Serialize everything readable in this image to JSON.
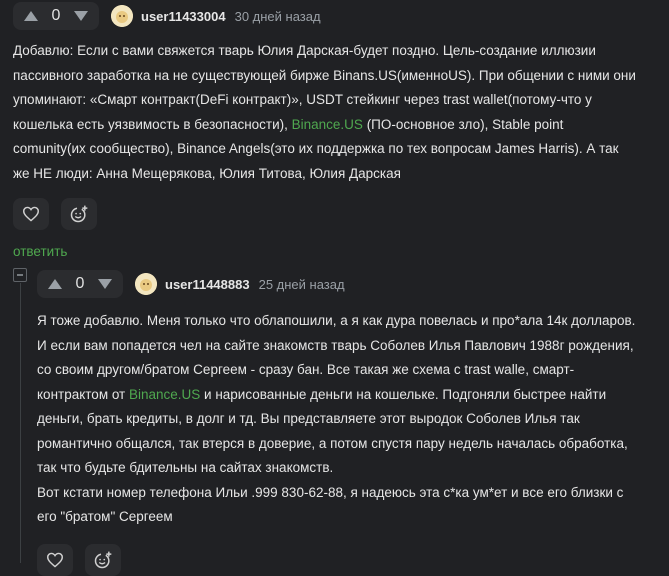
{
  "comments": [
    {
      "votes": "0",
      "user": "user11433004",
      "time": "30 дней назад",
      "lines": [
        [
          {
            "t": "Добавлю: Если с вами свяжется тварь Юлия Дарская-будет поздно. Цель-создание иллюзии"
          }
        ],
        [
          {
            "t": "пассивного заработка на не существующей бирже Binans.US(именноUS). При общении с ними они"
          }
        ],
        [
          {
            "t": "упоминают: «Смарт контракт(DeFi контракт)», USDT стейкинг через trast wallet(потому-что у"
          }
        ],
        [
          {
            "t": "кошелька есть уязвимость в безопасности), "
          },
          {
            "t": "Binance.US",
            "link": true
          },
          {
            "t": " (ПО-основное зло), Stable point"
          }
        ],
        [
          {
            "t": "comunity(их сообщество), Binance Angels(это их поддержка по тех вопросам James Harris). А так"
          }
        ],
        [
          {
            "t": "же НЕ люди: Анна Мещерякова, Юлия Титова, Юлия Дарская"
          }
        ]
      ],
      "reply_label": "ответить"
    },
    {
      "votes": "0",
      "user": "user11448883",
      "time": "25 дней назад",
      "lines": [
        [
          {
            "t": "Я тоже добавлю. Меня только что облапошили, а я как дура повелась и про*ала 14к долларов."
          }
        ],
        [
          {
            "t": "И если вам попадется чел на сайте знакомств тварь Соболев Илья Павлович 1988г рождения,"
          }
        ],
        [
          {
            "t": "со своим другом/братом Сергеем - сразу бан. Все такая же схема с trast walle, смарт-"
          }
        ],
        [
          {
            "t": "контрактом от "
          },
          {
            "t": "Binance.US",
            "link": true
          },
          {
            "t": " и нарисованные деньги на кошельке. Подгоняли быстрее найти"
          }
        ],
        [
          {
            "t": "деньги, брать кредиты, в долг и тд. Вы представляете этот выродок Соболев Илья так"
          }
        ],
        [
          {
            "t": "романтично общался, так втерся в доверие, а потом спустя пару недель началась обработка,"
          }
        ],
        [
          {
            "t": "так что будьте бдительны на сайтах знакомств."
          }
        ],
        [
          {
            "t": "Вот кстати номер телефона Ильи .999 830-62-88, я надеюсь эта с*ка ум*ет и все его близки с"
          }
        ],
        [
          {
            "t": "его \"братом\" Сергеем"
          }
        ]
      ]
    }
  ],
  "icons": {
    "upvote": "arrow-up-icon",
    "downvote": "arrow-down-icon",
    "like": "heart-icon",
    "react": "emoji-add-icon",
    "collapse": "collapse-minus-icon"
  },
  "colors": {
    "background": "#202124",
    "accent": "#4fa84f",
    "muted": "#9aa0a6"
  }
}
